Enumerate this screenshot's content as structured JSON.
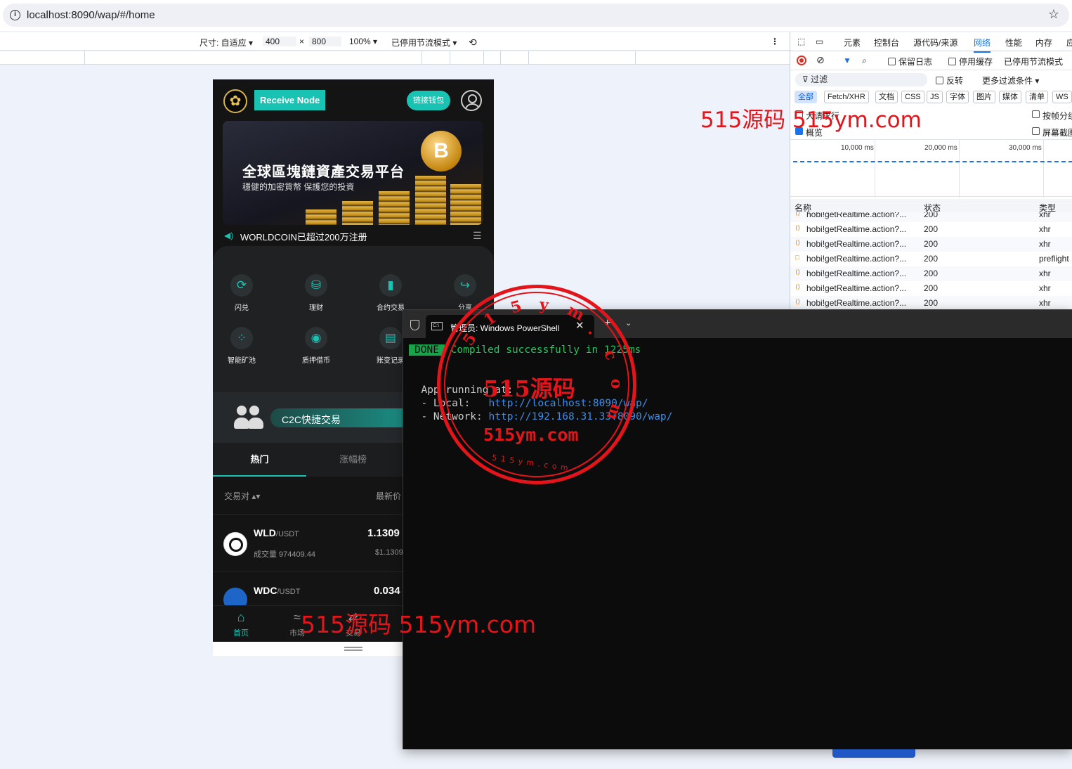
{
  "browser": {
    "url": "localhost:8090/wap/#/home"
  },
  "device_toolbar": {
    "size_label": "尺寸: 自适应 ▾",
    "width": "400",
    "times": "×",
    "height": "800",
    "zoom": "100% ▾",
    "throttle": "已停用节流模式 ▾"
  },
  "app": {
    "node_button": "Receive Node",
    "wallet_button": "链接钱包",
    "banner_title": "全球區塊鏈資產交易平台",
    "banner_subtitle": "穩健的加密貨幣 保護您的投資",
    "coin_letter": "B",
    "notice": "WORLDCOIN已超过200万注册",
    "functions": [
      {
        "label": "闪兑",
        "icon": "swap-icon",
        "glyph": "⟳"
      },
      {
        "label": "理财",
        "icon": "coins-icon",
        "glyph": "⛁"
      },
      {
        "label": "合约交易",
        "icon": "bar-chart-icon",
        "glyph": "▮"
      },
      {
        "label": "分享",
        "icon": "share-icon",
        "glyph": "↪"
      },
      {
        "label": "智能矿池",
        "icon": "scatter-icon",
        "glyph": "⁘"
      },
      {
        "label": "质押借币",
        "icon": "pledge-icon",
        "glyph": "◉"
      },
      {
        "label": "账变记录",
        "icon": "record-icon",
        "glyph": "▤"
      }
    ],
    "c2c_label": "C2C快捷交易",
    "tabs": [
      "热门",
      "涨幅榜"
    ],
    "market_header": {
      "pair": "交易对 ▴▾",
      "price": "最新价"
    },
    "rows": [
      {
        "symbol": "WLD",
        "quote": "/USDT",
        "volume": "成交量 974409.44",
        "price": "1.1309",
        "usd": "$1.1309"
      },
      {
        "symbol": "WDC",
        "quote": "/USDT",
        "volume": "",
        "price": "0.034",
        "usd": ""
      }
    ],
    "tabbar": [
      {
        "label": "首页",
        "icon": "home-icon",
        "glyph": "⌂",
        "active": true
      },
      {
        "label": "市场",
        "icon": "market-icon",
        "glyph": "≈",
        "active": false
      },
      {
        "label": "交易",
        "icon": "trade-icon",
        "glyph": "⇄",
        "active": false
      }
    ]
  },
  "devtools": {
    "tabs": [
      "元素",
      "控制台",
      "源代码/来源",
      "网络",
      "性能",
      "内存",
      "应"
    ],
    "active_tab": "网络",
    "toolbar": {
      "preserve_log": "保留日志",
      "disable_cache": "停用缓存",
      "throttle": "已停用节流模式"
    },
    "filter": {
      "placeholder": "过滤",
      "invert": "反转",
      "more": "更多过滤条件 ▾"
    },
    "types": [
      "全部",
      "Fetch/XHR",
      "文档",
      "CSS",
      "JS",
      "字体",
      "图片",
      "媒体",
      "清单",
      "WS"
    ],
    "options": {
      "big_rows": "大请求行",
      "overview": "概览",
      "group_by_frame": "按帧分组",
      "screenshots": "屏幕截图"
    },
    "timeline_labels": [
      "10,000 ms",
      "20,000 ms",
      "30,000 ms"
    ],
    "columns": {
      "name": "名称",
      "status": "状态",
      "type": "类型"
    },
    "requests": [
      {
        "name": "hobi!getRealtime.action?...",
        "status": "200",
        "type": "xhr"
      },
      {
        "name": "hobi!getRealtime.action?...",
        "status": "200",
        "type": "xhr"
      },
      {
        "name": "hobi!getRealtime.action?...",
        "status": "200",
        "type": "xhr"
      },
      {
        "name": "hobi!getRealtime.action?...",
        "status": "200",
        "type": "preflight"
      },
      {
        "name": "hobi!getRealtime.action?...",
        "status": "200",
        "type": "xhr"
      },
      {
        "name": "hobi!getRealtime.action?...",
        "status": "200",
        "type": "xhr"
      },
      {
        "name": "hobi!getRealtime.action?...",
        "status": "200",
        "type": "xhr"
      }
    ]
  },
  "powershell": {
    "tab_title": "管理员: Windows PowerShell",
    "done_badge": "DONE",
    "compiled": "Compiled successfully in 1225ms",
    "running": "App running at:",
    "local_label": "- Local:   ",
    "local_url": "http://localhost:8090/wap/",
    "network_label": "- Network: ",
    "network_url": "http://192.168.31.33:8090/wap/"
  },
  "watermarks": {
    "top": "515源码 515ym.com",
    "bottom": "515源码 515ym.com",
    "stamp_center": "515源码",
    "stamp_domain": "515ym.com",
    "stamp_ring": "515ym.com",
    "stamp_footer": "5 1 5 y m . c o m"
  },
  "colors": {
    "accent": "#19c3b3",
    "devtools_blue": "#1a73e8",
    "watermark": "#e3151b",
    "terminal_bg": "#0c0c0c"
  }
}
